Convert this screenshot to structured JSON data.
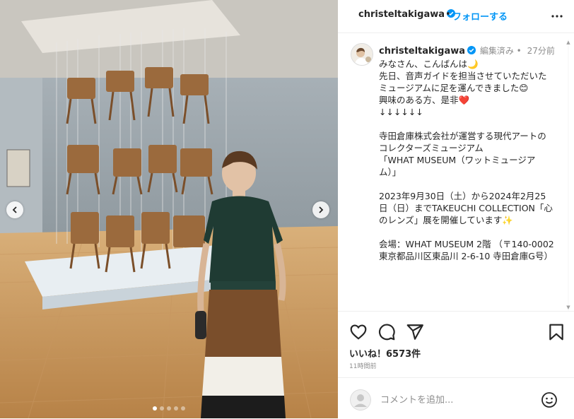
{
  "post": {
    "username": "christeltakigawa",
    "follow_label": "フォローする",
    "header_separator": "•"
  },
  "caption": {
    "username": "christeltakigawa",
    "edited": "編集済み •",
    "time": "27分前",
    "text": "みなさん、こんばんは🌙\n先日、音声ガイドを担当させていただいた\nミュージアムに足を運んできました😊\n興味のある方、是非❤️\n↓↓↓↓↓↓\n\n寺田倉庫株式会社が運営する現代アートのコレクターズミュージアム\n「WHAT MUSEUM（ワットミュージアム）」\n\n2023年9月30日（土）から2024年2月25日（日）までTAKEUCHI COLLECTION「心のレンズ」展を開催しています✨\n\n会場：WHAT MUSEUM 2階 （〒140-0002 東京都品川区東品川 2-6-10 寺田倉庫G号）"
  },
  "engagement": {
    "likes": "いいね！6573件",
    "time_ago": "11時間前"
  },
  "comment": {
    "placeholder": "コメントを追加..."
  },
  "carousel": {
    "total": 5,
    "active_index": 0
  },
  "colors": {
    "accent": "#0095f6",
    "verified": "#0095f6",
    "text": "#262626",
    "muted": "#8e8e8e"
  },
  "icons": {
    "like": "heart-icon",
    "comment": "comment-icon",
    "share": "share-icon",
    "save": "bookmark-icon",
    "more": "more-icon",
    "emoji": "emoji-icon",
    "verified": "verified-badge-icon",
    "prev": "chevron-left-icon",
    "next": "chevron-right-icon"
  }
}
